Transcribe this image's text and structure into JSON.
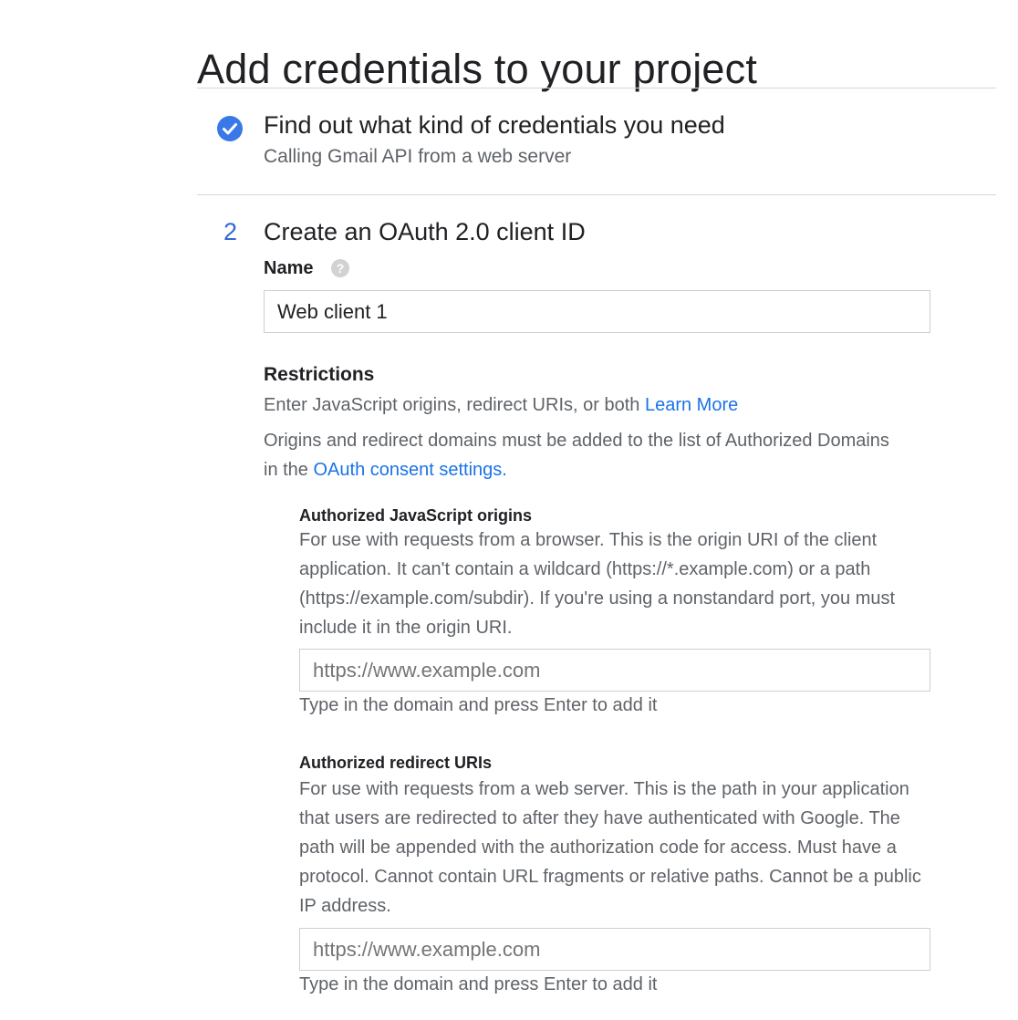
{
  "page": {
    "title": "Add credentials to your project"
  },
  "step1": {
    "title": "Find out what kind of credentials you need",
    "subtitle": "Calling Gmail API from a web server",
    "icon": "check-circle-icon",
    "icon_color": "#3b78e7"
  },
  "step2": {
    "number": "2",
    "title": "Create an OAuth 2.0 client ID",
    "name_label": "Name",
    "help_icon": "?",
    "name_value": "Web client 1"
  },
  "restrictions": {
    "heading": "Restrictions",
    "description": "Enter JavaScript origins, redirect URIs, or both",
    "learn_more": "Learn More",
    "domains_note": "Origins and redirect domains must be added to the list of Authorized Domains in the",
    "consent_link": "OAuth consent settings.",
    "origins": {
      "heading": "Authorized JavaScript origins",
      "description": "For use with requests from a browser. This is the origin URI of the client application. It can't contain a wildcard (https://*.example.com) or a path (https://example.com/subdir). If you're using a nonstandard port, you must include it in the origin URI.",
      "placeholder": "https://www.example.com",
      "hint": "Type in the domain and press Enter to add it"
    },
    "redirects": {
      "heading": "Authorized redirect URIs",
      "description": "For use with requests from a web server. This is the path in your application that users are redirected to after they have authenticated with Google. The path will be appended with the authorization code for access. Must have a protocol. Cannot contain URL fragments or relative paths. Cannot be a public IP address.",
      "placeholder": "https://www.example.com",
      "hint": "Type in the domain and press Enter to add it"
    }
  },
  "colors": {
    "accent": "#3367d6",
    "link": "#1a73e8"
  }
}
